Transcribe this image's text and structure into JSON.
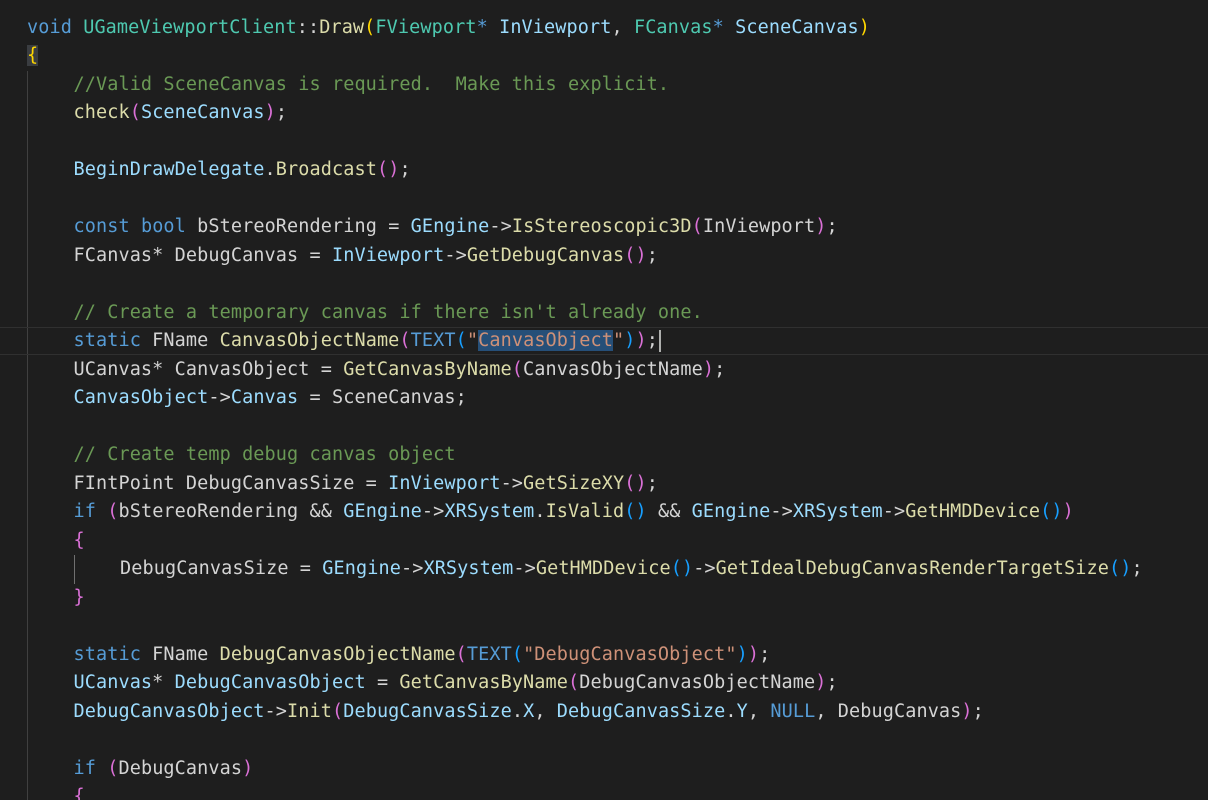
{
  "editor": {
    "language": "cpp",
    "theme": "dark",
    "lines": [
      {
        "indent": 0,
        "tokens": [
          [
            "kw",
            "void"
          ],
          [
            "pl",
            " "
          ],
          [
            "ty",
            "UGameViewportClient"
          ],
          [
            "pl",
            "::"
          ],
          [
            "fn",
            "Draw"
          ],
          [
            "br1",
            "("
          ],
          [
            "ty",
            "FViewport"
          ],
          [
            "kw",
            "*"
          ],
          [
            "pl",
            " "
          ],
          [
            "var",
            "InViewport"
          ],
          [
            "pl",
            ", "
          ],
          [
            "ty",
            "FCanvas"
          ],
          [
            "kw",
            "*"
          ],
          [
            "pl",
            " "
          ],
          [
            "var",
            "SceneCanvas"
          ],
          [
            "br1",
            ")"
          ]
        ]
      },
      {
        "indent": 0,
        "tokens": [
          [
            "br1 bgt",
            "{"
          ]
        ]
      },
      {
        "indent": 1,
        "tokens": [
          [
            "cm",
            "//Valid SceneCanvas is required.  Make this explicit."
          ]
        ]
      },
      {
        "indent": 1,
        "tokens": [
          [
            "fn",
            "check"
          ],
          [
            "br2",
            "("
          ],
          [
            "var",
            "SceneCanvas"
          ],
          [
            "br2",
            ")"
          ],
          [
            "pl",
            ";"
          ]
        ]
      },
      {
        "indent": 1,
        "tokens": []
      },
      {
        "indent": 1,
        "tokens": [
          [
            "var",
            "BeginDrawDelegate"
          ],
          [
            "pl",
            "."
          ],
          [
            "fn",
            "Broadcast"
          ],
          [
            "br2",
            "()"
          ],
          [
            "pl",
            ";"
          ]
        ]
      },
      {
        "indent": 1,
        "tokens": []
      },
      {
        "indent": 1,
        "tokens": [
          [
            "kw",
            "const"
          ],
          [
            "pl",
            " "
          ],
          [
            "kw",
            "bool"
          ],
          [
            "pl",
            " bStereoRendering = "
          ],
          [
            "var",
            "GEngine"
          ],
          [
            "pl",
            "->"
          ],
          [
            "fn",
            "IsStereoscopic3D"
          ],
          [
            "br2",
            "("
          ],
          [
            "pl",
            "InViewport"
          ],
          [
            "br2",
            ")"
          ],
          [
            "pl",
            ";"
          ]
        ]
      },
      {
        "indent": 1,
        "tokens": [
          [
            "pl",
            "FCanvas* DebugCanvas = "
          ],
          [
            "var",
            "InViewport"
          ],
          [
            "pl",
            "->"
          ],
          [
            "fn",
            "GetDebugCanvas"
          ],
          [
            "br2",
            "()"
          ],
          [
            "pl",
            ";"
          ]
        ]
      },
      {
        "indent": 1,
        "tokens": []
      },
      {
        "indent": 1,
        "tokens": [
          [
            "cm",
            "// Create a temporary canvas if there isn't already one."
          ]
        ]
      },
      {
        "indent": 1,
        "current": true,
        "tokens": [
          [
            "kw",
            "static"
          ],
          [
            "pl",
            " FName "
          ],
          [
            "fn",
            "CanvasObjectName"
          ],
          [
            "br2",
            "("
          ],
          [
            "macro",
            "TEXT"
          ],
          [
            "br3",
            "("
          ],
          [
            "str",
            "\""
          ],
          [
            "str selection",
            "CanvasObject"
          ],
          [
            "str",
            "\""
          ],
          [
            "br3",
            ")"
          ],
          [
            "br2",
            ")"
          ],
          [
            "pl",
            ";"
          ],
          [
            "cursor",
            ""
          ]
        ]
      },
      {
        "indent": 1,
        "tokens": [
          [
            "pl",
            "UCanvas* CanvasObject = "
          ],
          [
            "fn",
            "GetCanvasByName"
          ],
          [
            "br2",
            "("
          ],
          [
            "pl",
            "CanvasObjectName"
          ],
          [
            "br2",
            ")"
          ],
          [
            "pl",
            ";"
          ]
        ]
      },
      {
        "indent": 1,
        "tokens": [
          [
            "var",
            "CanvasObject"
          ],
          [
            "pl",
            "->"
          ],
          [
            "var",
            "Canvas"
          ],
          [
            "pl",
            " = SceneCanvas;"
          ]
        ]
      },
      {
        "indent": 1,
        "tokens": []
      },
      {
        "indent": 1,
        "tokens": [
          [
            "cm",
            "// Create temp debug canvas object"
          ]
        ]
      },
      {
        "indent": 1,
        "tokens": [
          [
            "pl",
            "FIntPoint DebugCanvasSize = "
          ],
          [
            "var",
            "InViewport"
          ],
          [
            "pl",
            "->"
          ],
          [
            "fn",
            "GetSizeXY"
          ],
          [
            "br2",
            "()"
          ],
          [
            "pl",
            ";"
          ]
        ]
      },
      {
        "indent": 1,
        "tokens": [
          [
            "kw",
            "if"
          ],
          [
            "pl",
            " "
          ],
          [
            "br2",
            "("
          ],
          [
            "pl",
            "bStereoRendering && "
          ],
          [
            "var",
            "GEngine"
          ],
          [
            "pl",
            "->"
          ],
          [
            "var",
            "XRSystem"
          ],
          [
            "pl",
            "."
          ],
          [
            "fn",
            "IsValid"
          ],
          [
            "br3",
            "()"
          ],
          [
            "pl",
            " && "
          ],
          [
            "var",
            "GEngine"
          ],
          [
            "pl",
            "->"
          ],
          [
            "var",
            "XRSystem"
          ],
          [
            "pl",
            "->"
          ],
          [
            "fn",
            "GetHMDDevice"
          ],
          [
            "br3",
            "()"
          ],
          [
            "br2",
            ")"
          ]
        ]
      },
      {
        "indent": 1,
        "tokens": [
          [
            "br2",
            "{"
          ]
        ]
      },
      {
        "indent": 2,
        "tokens": [
          [
            "pl",
            "DebugCanvasSize = "
          ],
          [
            "var",
            "GEngine"
          ],
          [
            "pl",
            "->"
          ],
          [
            "var",
            "XRSystem"
          ],
          [
            "pl",
            "->"
          ],
          [
            "fn",
            "GetHMDDevice"
          ],
          [
            "br3",
            "()"
          ],
          [
            "pl",
            "->"
          ],
          [
            "fn",
            "GetIdealDebugCanvasRenderTargetSize"
          ],
          [
            "br3",
            "()"
          ],
          [
            "pl",
            ";"
          ]
        ]
      },
      {
        "indent": 1,
        "tokens": [
          [
            "br2",
            "}"
          ]
        ]
      },
      {
        "indent": 1,
        "tokens": []
      },
      {
        "indent": 1,
        "tokens": [
          [
            "kw",
            "static"
          ],
          [
            "pl",
            " FName "
          ],
          [
            "fn",
            "DebugCanvasObjectName"
          ],
          [
            "br2",
            "("
          ],
          [
            "macro",
            "TEXT"
          ],
          [
            "br3",
            "("
          ],
          [
            "str",
            "\"DebugCanvasObject\""
          ],
          [
            "br3",
            ")"
          ],
          [
            "br2",
            ")"
          ],
          [
            "pl",
            ";"
          ]
        ]
      },
      {
        "indent": 1,
        "tokens": [
          [
            "var",
            "UCanvas"
          ],
          [
            "pl",
            "* "
          ],
          [
            "var",
            "DebugCanvasObject"
          ],
          [
            "pl",
            " = "
          ],
          [
            "fn",
            "GetCanvasByName"
          ],
          [
            "br2",
            "("
          ],
          [
            "pl",
            "DebugCanvasObjectName"
          ],
          [
            "br2",
            ")"
          ],
          [
            "pl",
            ";"
          ]
        ]
      },
      {
        "indent": 1,
        "tokens": [
          [
            "var",
            "DebugCanvasObject"
          ],
          [
            "pl",
            "->"
          ],
          [
            "fn",
            "Init"
          ],
          [
            "br2",
            "("
          ],
          [
            "var",
            "DebugCanvasSize"
          ],
          [
            "pl",
            "."
          ],
          [
            "var",
            "X"
          ],
          [
            "pl",
            ", "
          ],
          [
            "var",
            "DebugCanvasSize"
          ],
          [
            "pl",
            "."
          ],
          [
            "var",
            "Y"
          ],
          [
            "pl",
            ", "
          ],
          [
            "kw",
            "NULL"
          ],
          [
            "pl",
            ", DebugCanvas"
          ],
          [
            "br2",
            ")"
          ],
          [
            "pl",
            ";"
          ]
        ]
      },
      {
        "indent": 1,
        "tokens": []
      },
      {
        "indent": 1,
        "tokens": [
          [
            "kw",
            "if"
          ],
          [
            "pl",
            " "
          ],
          [
            "br2",
            "("
          ],
          [
            "pl",
            "DebugCanvas"
          ],
          [
            "br2",
            ")"
          ]
        ]
      },
      {
        "indent": 1,
        "tokens": [
          [
            "br2",
            "{"
          ]
        ]
      }
    ]
  }
}
